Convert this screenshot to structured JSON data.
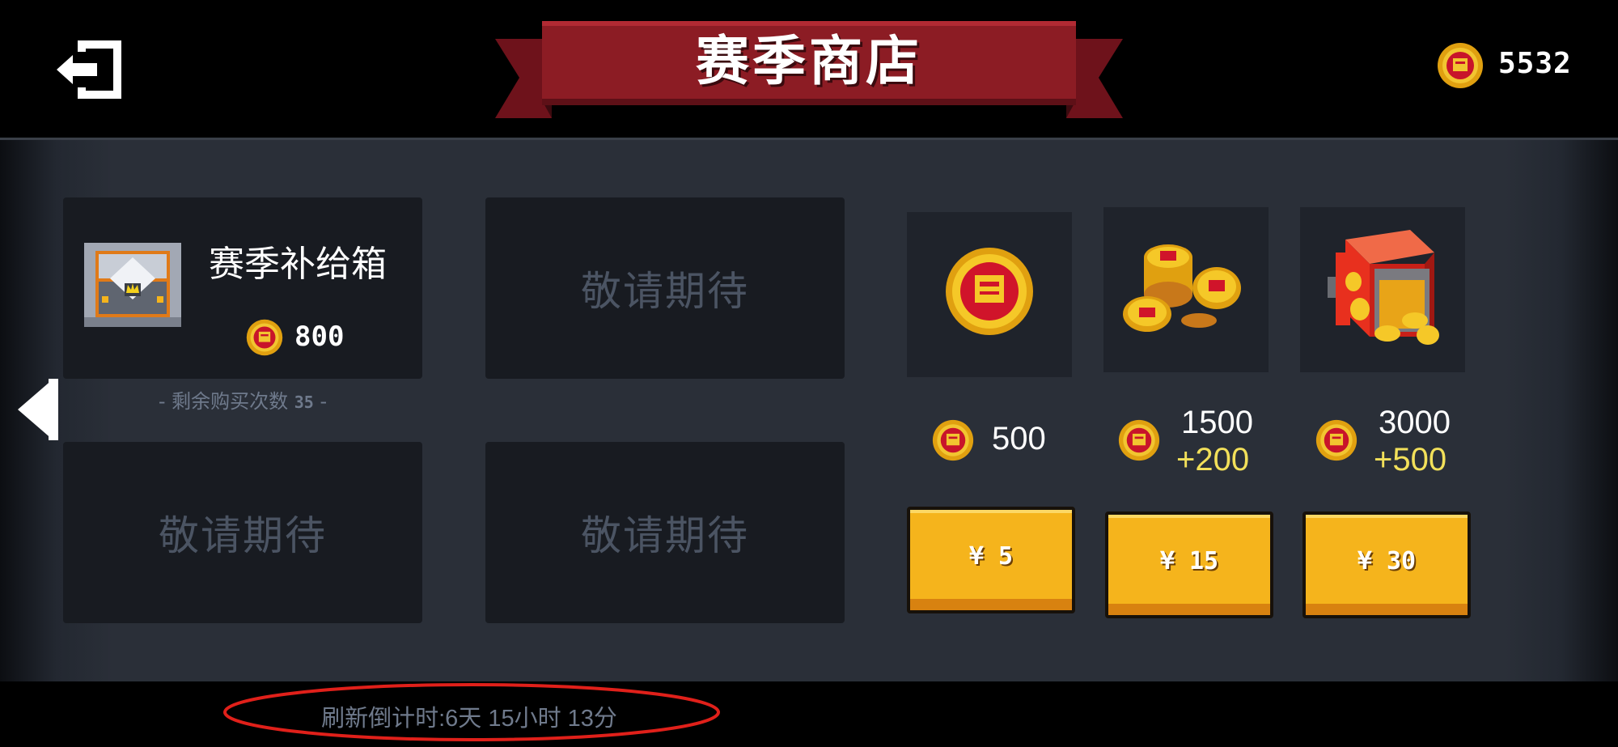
{
  "header": {
    "title": "赛季商店",
    "balance": "5532",
    "exit_icon": "exit-icon",
    "balance_icon": "coin-icon"
  },
  "shop_items": [
    {
      "name": "赛季补给箱",
      "price": "800",
      "remaining_label": "剩余购买次数",
      "remaining_count": "35",
      "icon": "treasure-chest-icon"
    },
    {
      "placeholder": "敬请期待"
    },
    {
      "placeholder": "敬请期待"
    },
    {
      "placeholder": "敬请期待"
    }
  ],
  "coin_packs": [
    {
      "amount": "500",
      "bonus": "",
      "button": "¥ 5",
      "icon": "single-coin-icon"
    },
    {
      "amount": "1500",
      "bonus": "+200",
      "button": "¥ 15",
      "icon": "coin-pile-icon"
    },
    {
      "amount": "3000",
      "bonus": "+500",
      "button": "¥ 30",
      "icon": "coin-safe-icon"
    }
  ],
  "footer": {
    "refresh_countdown": "刷新倒计时:6天 15小时 13分"
  },
  "colors": {
    "ribbon": "#8c1c24",
    "button": "#f5b41c",
    "bonus": "#f2e05a",
    "highlight_ring": "#e0201a"
  }
}
